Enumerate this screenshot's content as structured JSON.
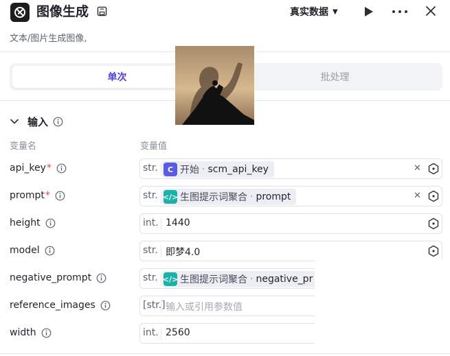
{
  "header": {
    "title": "图像生成",
    "description": "文本/图片生成图像,",
    "mode": "真实数据"
  },
  "tabs": [
    {
      "label": "单次",
      "active": true
    },
    {
      "label": "批处理",
      "active": false
    }
  ],
  "section": {
    "title": "输入",
    "col_name": "变量名",
    "col_value": "变量值"
  },
  "fields": [
    {
      "name": "api_key",
      "required": true,
      "type": "str.",
      "kind": "ref",
      "ref_icon": "start-node-icon",
      "ref_source": "开始",
      "ref_var": "scm_api_key",
      "clearable": true
    },
    {
      "name": "prompt",
      "required": true,
      "type": "str.",
      "kind": "ref",
      "ref_icon": "code-node-icon",
      "ref_source": "生图提示词聚合",
      "ref_var": "prompt",
      "clearable": true
    },
    {
      "name": "height",
      "required": false,
      "type": "int.",
      "kind": "value",
      "value": "1440"
    },
    {
      "name": "model",
      "required": false,
      "type": "str.",
      "kind": "value",
      "value": "即梦4.0"
    },
    {
      "name": "negative_prompt",
      "required": false,
      "type": "str.",
      "kind": "ref",
      "ref_icon": "code-node-icon",
      "ref_source": "生图提示词聚合",
      "ref_var": "negative_pr"
    },
    {
      "name": "reference_images",
      "required": false,
      "type": "[str.]",
      "kind": "placeholder",
      "placeholder": "输入或引用参数值"
    },
    {
      "name": "width",
      "required": false,
      "type": "int.",
      "kind": "value",
      "value": "2560"
    }
  ],
  "colors": {
    "accent": "#4e40e5",
    "required": "#e5484d",
    "ref_blue": "#5b5ce6",
    "ref_teal": "#1ab2a8"
  }
}
